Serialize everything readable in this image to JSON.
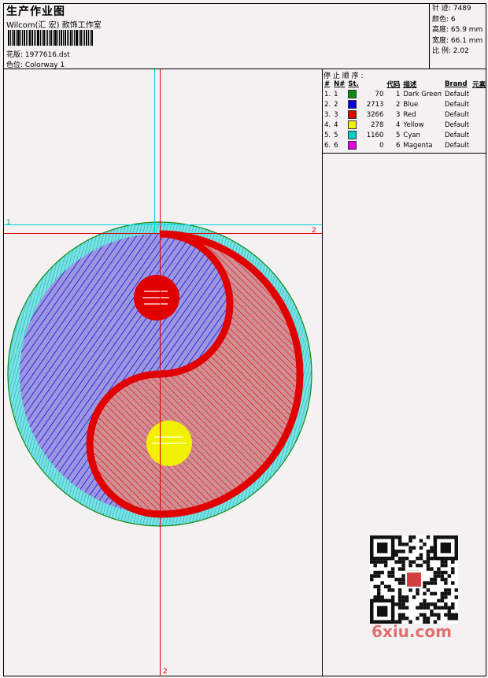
{
  "header": {
    "title": "生产作业图",
    "subtitle": "Wilcom(汇 宏) 款饰工作室",
    "design_label": "花版: 1977616.dst",
    "colorway_label": "色位:  Colorway 1"
  },
  "stats": {
    "stitches": "针 迹:  7489",
    "colors": "颜色:  6",
    "height": "高度:  65.9 mm",
    "width": "宽度:  66.1 mm",
    "scale": "比 例:  2.02"
  },
  "stop_sequence": {
    "title": "停 止 顺 序 :",
    "headers": [
      "#",
      "N#",
      "St.",
      "代码",
      "描述",
      "Brand",
      "元素"
    ],
    "rows": [
      {
        "n": "1.",
        "nn": "1",
        "color": "#118a11",
        "st": "70",
        "code": "1",
        "desc": "Dark Green",
        "brand": "Default"
      },
      {
        "n": "2.",
        "nn": "2",
        "color": "#0000e0",
        "st": "2713",
        "code": "2",
        "desc": "Blue",
        "brand": "Default"
      },
      {
        "n": "3.",
        "nn": "3",
        "color": "#e00000",
        "st": "3266",
        "code": "3",
        "desc": "Red",
        "brand": "Default"
      },
      {
        "n": "4.",
        "nn": "4",
        "color": "#f0f000",
        "st": "278",
        "code": "4",
        "desc": "Yellow",
        "brand": "Default"
      },
      {
        "n": "5.",
        "nn": "5",
        "color": "#00d0d0",
        "st": "1160",
        "code": "5",
        "desc": "Cyan",
        "brand": "Default"
      },
      {
        "n": "6.",
        "nn": "6",
        "color": "#e000e0",
        "st": "0",
        "code": "6",
        "desc": "Magenta",
        "brand": "Default"
      }
    ]
  },
  "guides": {
    "label1": "1",
    "label2_top": "2",
    "label2_bottom": "2"
  },
  "watermark": "6xiu.com",
  "colors": {
    "cyan": "#00d8d8",
    "blue": "#0000e0",
    "red": "#e00000",
    "yellow": "#f0f000",
    "green": "#118a11"
  }
}
